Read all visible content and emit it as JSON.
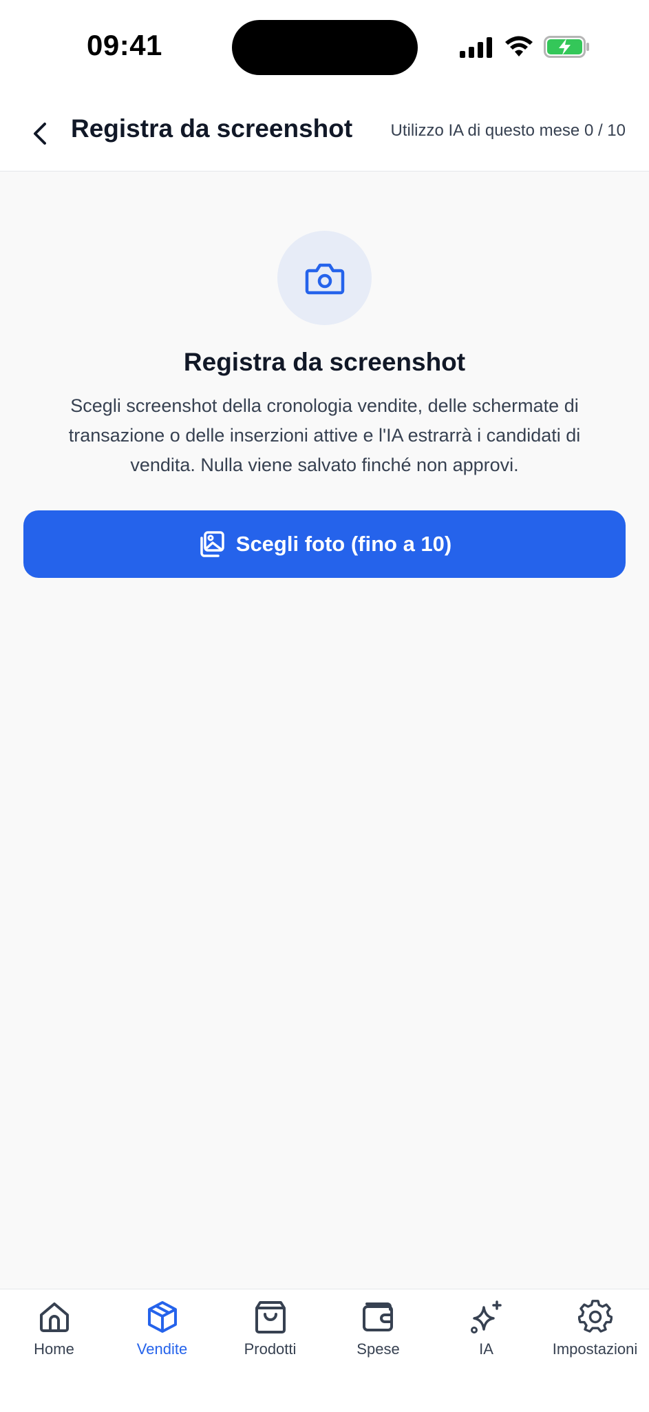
{
  "status_bar": {
    "time": "09:41",
    "icons": [
      "signal-icon",
      "wifi-icon",
      "battery-charging-icon"
    ],
    "battery_color": "#34c759"
  },
  "header": {
    "title": "Registra da screenshot",
    "usage": "Utilizzo IA di questo mese 0 / 10",
    "back_icon": "chevron-left-icon"
  },
  "main": {
    "icon": "camera-icon",
    "heading": "Registra da screenshot",
    "description": "Scegli screenshot della cronologia vendite, delle schermate di transazione o delle inserzioni attive e l'IA estrarrà i candidati di vendita. Nulla viene salvato finché non approvi.",
    "button_label": "Scegli foto (fino a 10)",
    "button_icon": "photo-gallery-icon"
  },
  "tabs": [
    {
      "label": "Home",
      "icon": "home-icon",
      "active": false
    },
    {
      "label": "Vendite",
      "icon": "box-icon",
      "active": true
    },
    {
      "label": "Prodotti",
      "icon": "shopping-bag-icon",
      "active": false
    },
    {
      "label": "Spese",
      "icon": "wallet-icon",
      "active": false
    },
    {
      "label": "IA",
      "icon": "sparkles-icon",
      "active": false
    },
    {
      "label": "Impostazioni",
      "icon": "gear-icon",
      "active": false
    }
  ],
  "colors": {
    "accent": "#2563eb",
    "background": "#f9f9f9",
    "icon_circle": "#e7ecf7",
    "text_primary": "#111827",
    "text_secondary": "#374151"
  }
}
